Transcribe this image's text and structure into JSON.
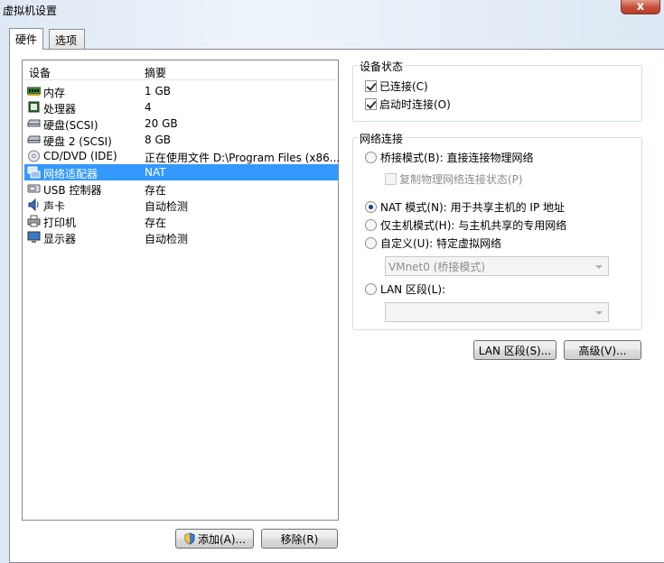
{
  "window": {
    "title": "虚拟机设置",
    "close_label": "x"
  },
  "tabs": [
    {
      "label": "硬件",
      "active": true
    },
    {
      "label": "选项",
      "active": false
    }
  ],
  "device_list": {
    "columns": {
      "device": "设备",
      "summary": "摘要"
    },
    "rows": [
      {
        "icon": "memory-icon",
        "name": "内存",
        "summary": "1 GB",
        "selected": false
      },
      {
        "icon": "processor-icon",
        "name": "处理器",
        "summary": "4",
        "selected": false
      },
      {
        "icon": "hard-disk-icon",
        "name": "硬盘(SCSI)",
        "summary": "20 GB",
        "selected": false
      },
      {
        "icon": "hard-disk-icon",
        "name": "硬盘 2 (SCSI)",
        "summary": "8 GB",
        "selected": false
      },
      {
        "icon": "cd-dvd-icon",
        "name": "CD/DVD (IDE)",
        "summary": "正在使用文件 D:\\Program Files (x86...",
        "selected": false
      },
      {
        "icon": "network-adapter-icon",
        "name": "网络适配器",
        "summary": "NAT",
        "selected": true
      },
      {
        "icon": "usb-icon",
        "name": "USB 控制器",
        "summary": "存在",
        "selected": false
      },
      {
        "icon": "sound-icon",
        "name": "声卡",
        "summary": "自动检测",
        "selected": false
      },
      {
        "icon": "printer-icon",
        "name": "打印机",
        "summary": "存在",
        "selected": false
      },
      {
        "icon": "display-icon",
        "name": "显示器",
        "summary": "自动检测",
        "selected": false
      }
    ]
  },
  "buttons": {
    "add": "添加(A)...",
    "remove": "移除(R)",
    "lan_segments": "LAN 区段(S)...",
    "advanced": "高级(V)..."
  },
  "device_status": {
    "group_label": "设备状态",
    "connected": {
      "label": "已连接(C)",
      "checked": true
    },
    "connect_at_power_on": {
      "label": "启动时连接(O)",
      "checked": true
    }
  },
  "network_connection": {
    "group_label": "网络连接",
    "bridged": {
      "label": "桥接模式(B): 直接连接物理网络",
      "checked": false
    },
    "replicate_state": {
      "label": "复制物理网络连接状态(P)",
      "checked": false,
      "enabled": false
    },
    "nat": {
      "label": "NAT 模式(N): 用于共享主机的 IP 地址",
      "checked": true
    },
    "host_only": {
      "label": "仅主机模式(H): 与主机共享的专用网络",
      "checked": false
    },
    "custom": {
      "label": "自定义(U): 特定虚拟网络",
      "checked": false
    },
    "custom_select_value": "VMnet0 (桥接模式)",
    "lan_segment": {
      "label": "LAN 区段(L):",
      "checked": false
    },
    "lan_segment_select_value": ""
  },
  "colors": {
    "selection": "#3399ff",
    "close_button": "#c7513c"
  }
}
